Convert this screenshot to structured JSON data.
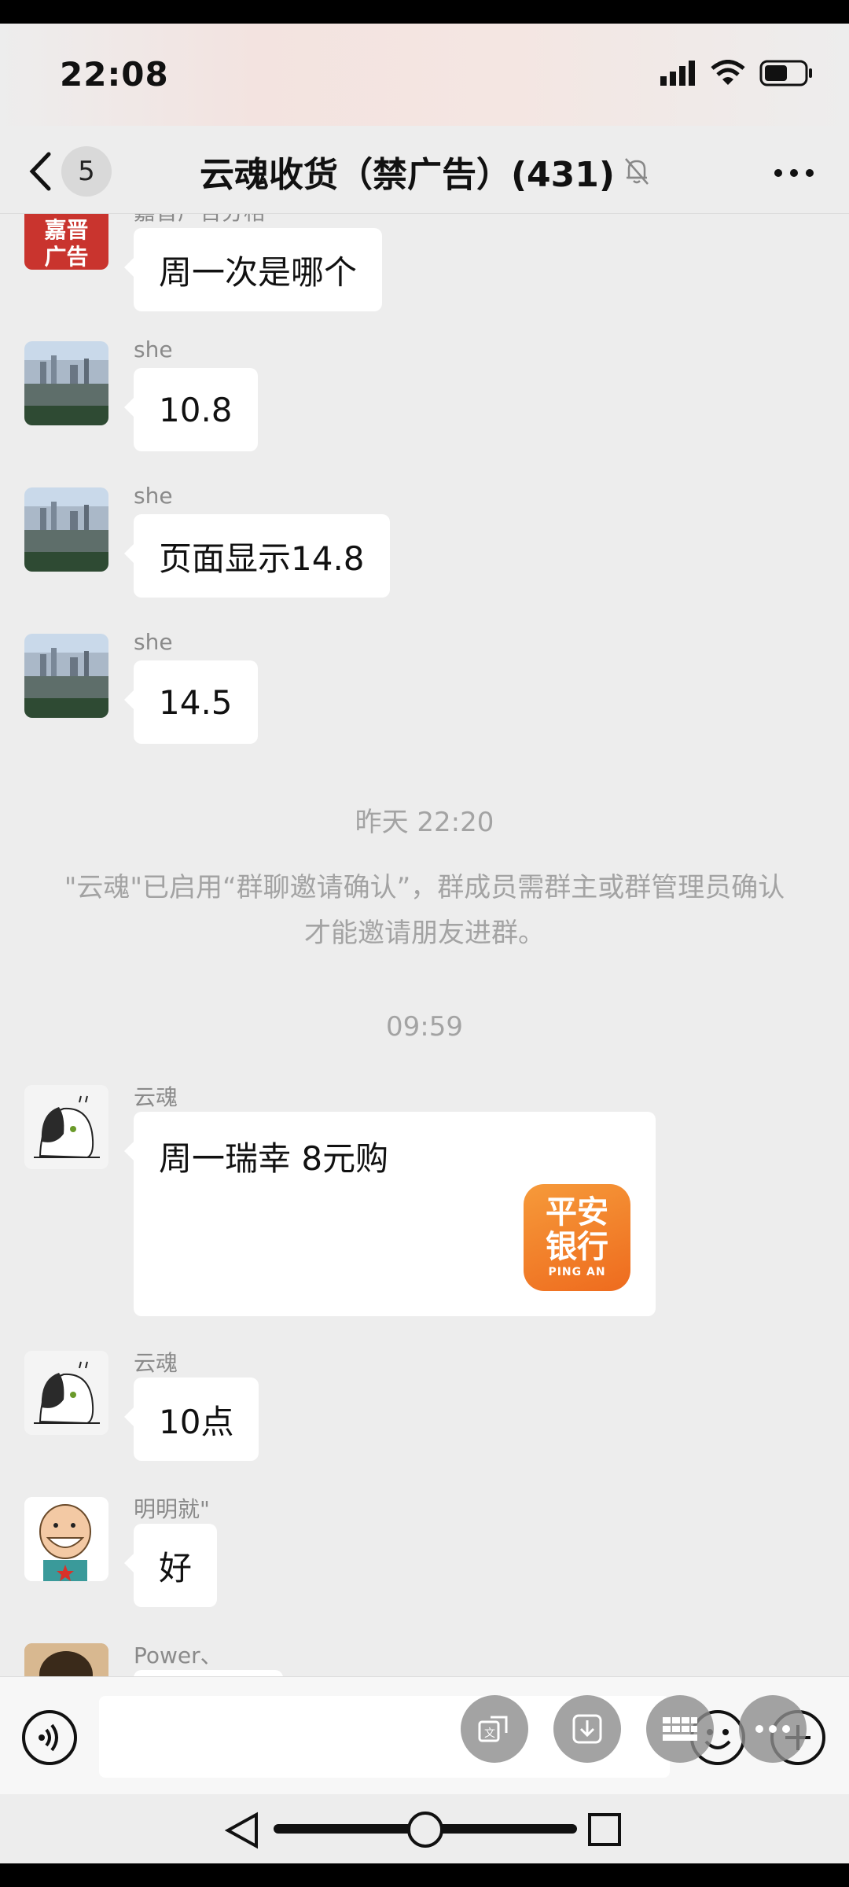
{
  "status": {
    "time": "22:08",
    "icons": [
      "signal-icon",
      "wifi-icon",
      "battery-icon"
    ]
  },
  "header": {
    "unread_count": "5",
    "title": "云魂收货（禁广告）(431)",
    "muted_icon": "bell-off-icon",
    "more_icon": "more-icon"
  },
  "chat": {
    "top_partial": {
      "sender": "嘉晋广告分格",
      "avatar_text_1": "嘉晋",
      "avatar_text_2": "广告",
      "text": "周一次是哪个"
    },
    "messages": [
      {
        "sender": "she",
        "text": "10.8"
      },
      {
        "sender": "she",
        "text": "页面显示14.8"
      },
      {
        "sender": "she",
        "text": "14.5"
      }
    ],
    "time_1": "昨天 22:20",
    "system_note": "\"云魂\"已启用“群聊邀请确认”，群成员需群主或群管理员确认才能邀请朋友进群。",
    "time_2": "09:59",
    "link_message": {
      "sender": "云魂",
      "title": "周一瑞幸 8元购",
      "logo_line1": "平安",
      "logo_line2": "银行",
      "logo_line3": "PING AN"
    },
    "messages_2": [
      {
        "sender": "云魂",
        "text": "10点"
      },
      {
        "sender": "明明就\"",
        "text": "好"
      }
    ],
    "bottom_partial": {
      "sender": "Power、"
    }
  },
  "input": {
    "placeholder": ""
  },
  "colors": {
    "background": "#ededed",
    "bubble": "#ffffff",
    "meta_text": "#a3a3a3",
    "pingan_orange": "#f08228"
  }
}
